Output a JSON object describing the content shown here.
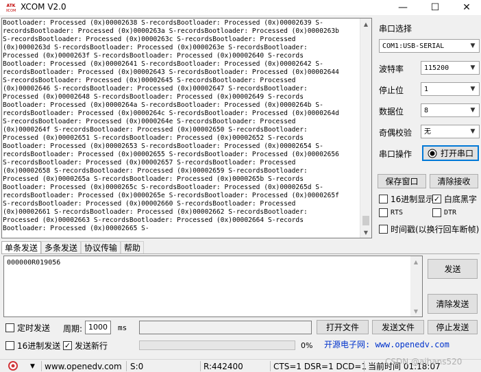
{
  "window": {
    "title": "XCOM V2.0",
    "logo_text": "ATK XCOM",
    "minimize": "—",
    "maximize": "☐",
    "close": "✕"
  },
  "receive": {
    "lines": [
      "Bootloader: Processed (0x)00002638 S-recordsBootloader: Processed (0x)00002639 S-",
      "recordsBootloader: Processed (0x)0000263a S-recordsBootloader: Processed (0x)0000263b",
      "S-recordsBootloader: Processed (0x)0000263c S-recordsBootloader: Processed",
      "(0x)0000263d S-recordsBootloader: Processed (0x)0000263e S-recordsBootloader:",
      "Processed (0x)0000263f S-recordsBootloader: Processed (0x)00002640 S-records",
      "Bootloader: Processed (0x)00002641 S-recordsBootloader: Processed (0x)00002642 S-",
      "recordsBootloader: Processed (0x)00002643 S-recordsBootloader: Processed (0x)00002644",
      "S-recordsBootloader: Processed (0x)00002645 S-recordsBootloader: Processed",
      "(0x)00002646 S-recordsBootloader: Processed (0x)00002647 S-recordsBootloader:",
      "Processed (0x)00002648 S-recordsBootloader: Processed (0x)00002649 S-records",
      "Bootloader: Processed (0x)0000264a S-recordsBootloader: Processed (0x)0000264b S-",
      "recordsBootloader: Processed (0x)0000264c S-recordsBootloader: Processed (0x)0000264d",
      "S-recordsBootloader: Processed (0x)0000264e S-recordsBootloader: Processed",
      "(0x)0000264f S-recordsBootloader: Processed (0x)00002650 S-recordsBootloader:",
      "Processed (0x)00002651 S-recordsBootloader: Processed (0x)00002652 S-records",
      "Bootloader: Processed (0x)00002653 S-recordsBootloader: Processed (0x)00002654 S-",
      "recordsBootloader: Processed (0x)00002655 S-recordsBootloader: Processed (0x)00002656",
      "S-recordsBootloader: Processed (0x)00002657 S-recordsBootloader: Processed",
      "(0x)00002658 S-recordsBootloader: Processed (0x)00002659 S-recordsBootloader:",
      "Processed (0x)0000265a S-recordsBootloader: Processed (0x)0000265b S-records",
      "Bootloader: Processed (0x)0000265c S-recordsBootloader: Processed (0x)0000265d S-",
      "recordsBootloader: Processed (0x)0000265e S-recordsBootloader: Processed (0x)0000265f",
      "S-recordsBootloader: Processed (0x)00002660 S-recordsBootloader: Processed",
      "(0x)00002661 S-recordsBootloader: Processed (0x)00002662 S-recordsBootloader:",
      "Processed (0x)00002663 S-recordsBootloader: Processed (0x)00002664 S-records",
      "Bootloader: Processed (0x)00002665 S-"
    ]
  },
  "settings": {
    "port_label": "串口选择",
    "port_value": "COM1:USB-SERIAL",
    "baud_label": "波特率",
    "baud_value": "115200",
    "stop_label": "停止位",
    "stop_value": "1",
    "data_label": "数据位",
    "data_value": "8",
    "parity_label": "奇偶校验",
    "parity_value": "无",
    "op_label": "串口操作",
    "open_button": "打开串口",
    "save_window": "保存窗口",
    "clear_recv": "清除接收",
    "hex_display": "16进制显示",
    "hex_display_checked": false,
    "white_bg": "白底黑字",
    "white_bg_checked": true,
    "rts": "RTS",
    "rts_checked": false,
    "dtr": "DTR",
    "dtr_checked": false,
    "timestamp": "时间戳(以换行回车断帧)",
    "timestamp_checked": false
  },
  "tabs": [
    "单条发送",
    "多条发送",
    "协议传输",
    "帮助"
  ],
  "send": {
    "text": "000000R019056",
    "send_button": "发送",
    "clear_send": "清除发送",
    "timed_send": "定时发送",
    "timed_send_checked": false,
    "period_label": "周期:",
    "period_value": "1000",
    "period_unit": "ms",
    "open_file": "打开文件",
    "send_file": "发送文件",
    "stop_send": "停止发送",
    "hex_send": "16进制发送",
    "hex_send_checked": false,
    "newline": "发送新行",
    "newline_checked": true,
    "progress_percent": 0,
    "progress_text": "0%",
    "website": "开源电子网: www.openedv.com"
  },
  "status": {
    "url": "www.openedv.com",
    "sent": "S:0",
    "received": "R:442400",
    "lines": "CTS=1 DSR=1 DCD=1",
    "time": "当前时间 01:18:07",
    "watermark": "CSDN @aihans520"
  }
}
